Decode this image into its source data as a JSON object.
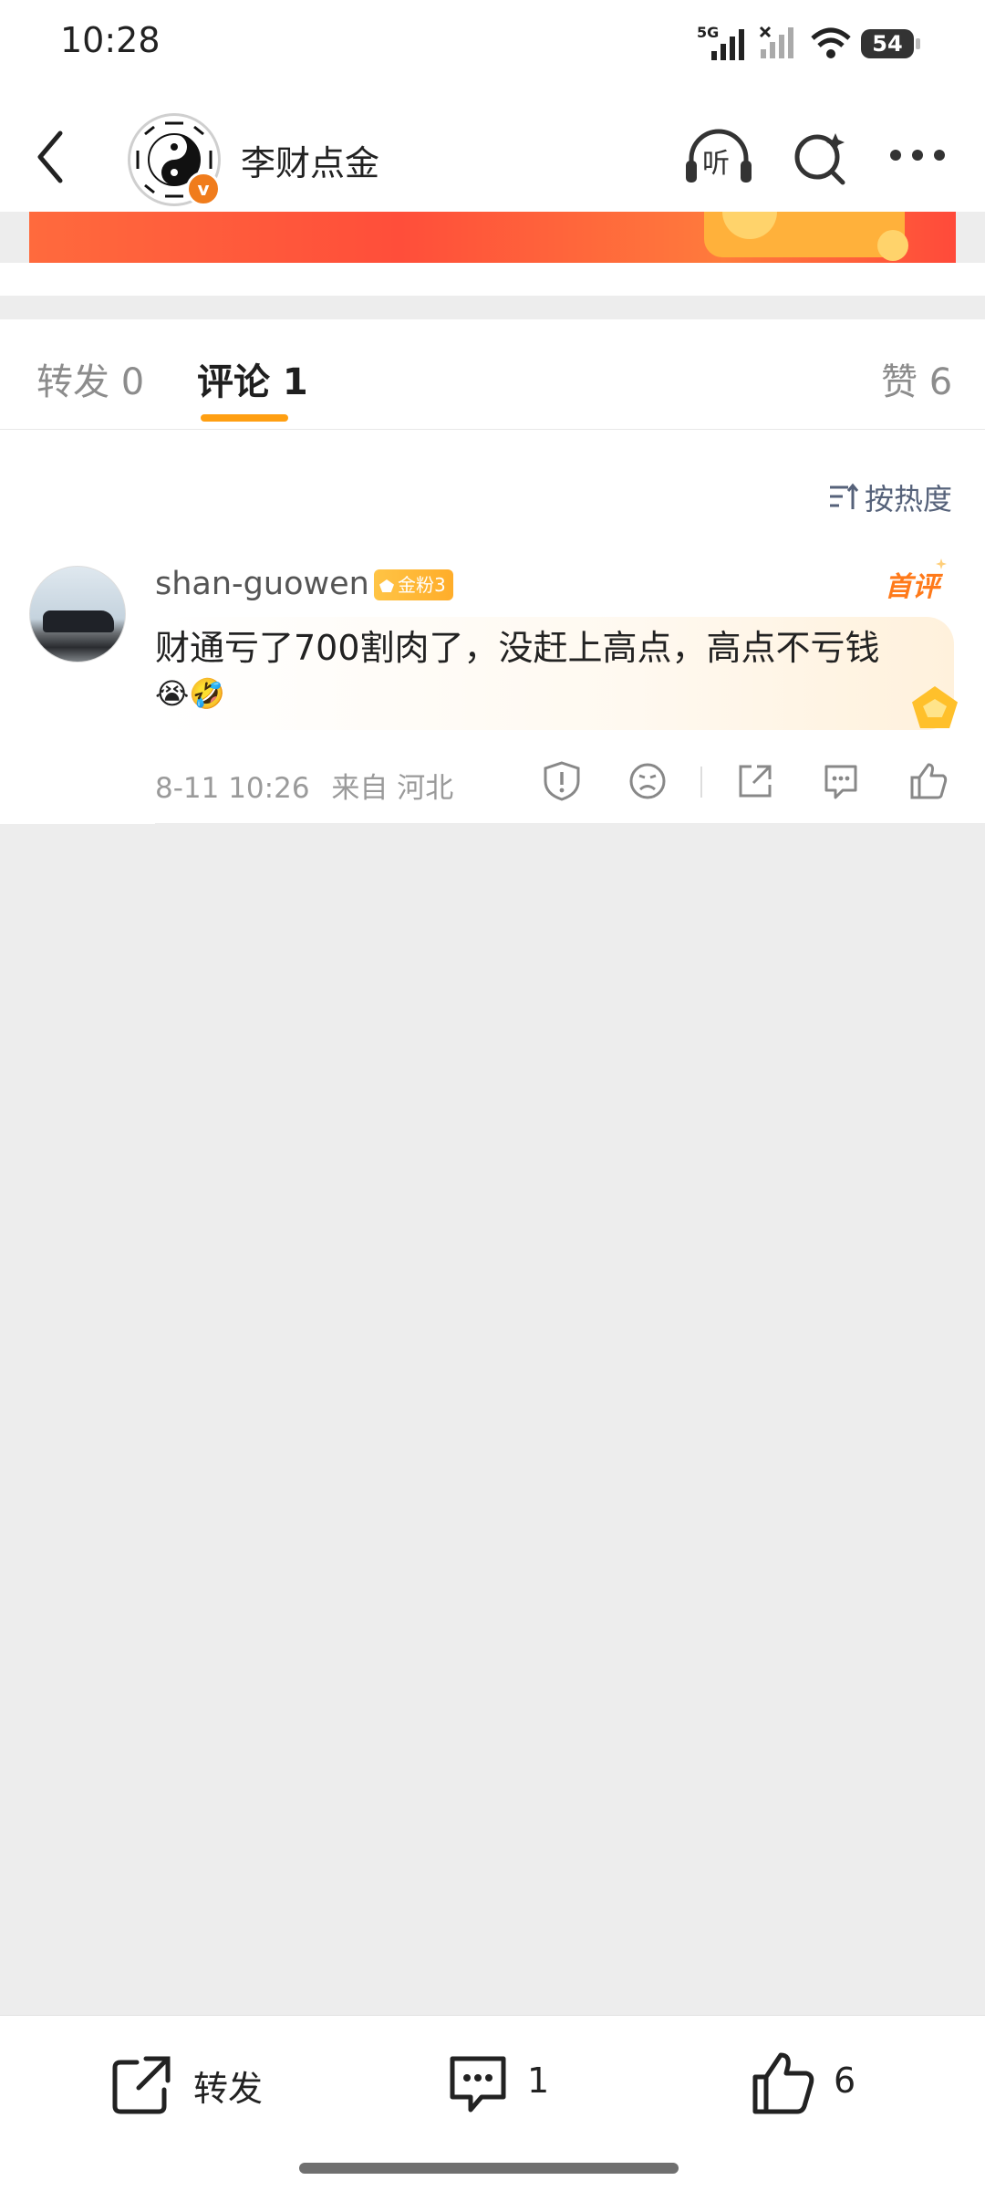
{
  "status_bar": {
    "time": "10:28",
    "network": "5G",
    "battery": "54"
  },
  "header": {
    "account_name": "李财点金",
    "listen_label": "听"
  },
  "tabs": {
    "repost": "转发 0",
    "comment": "评论 1",
    "like": "赞 6"
  },
  "sort_label": "按热度",
  "comment": {
    "username": "shan-guowen",
    "fan_badge": "金粉3",
    "first_tag": "首评",
    "text": "财通亏了700割肉了，没赶上高点，高点不亏钱",
    "emojis": "😭🤣",
    "time": "8-11 10:26",
    "location": "来自 河北"
  },
  "bottom_bar": {
    "repost_label": "转发",
    "comment_count": "1",
    "like_count": "6"
  },
  "colors": {
    "accent": "#ff9f12",
    "banner": "#ff5a3a",
    "background": "#ededed",
    "verified": "#f07c1c"
  }
}
